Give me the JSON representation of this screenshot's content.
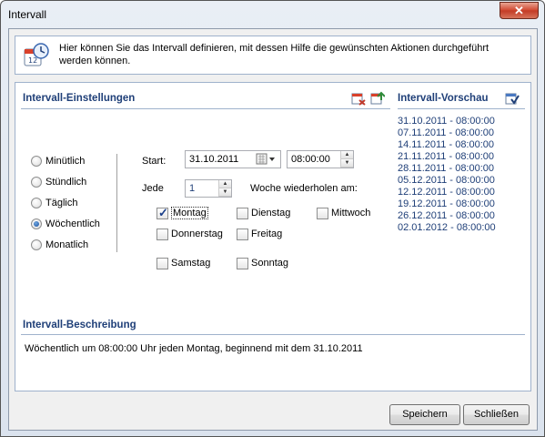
{
  "window": {
    "title": "Intervall",
    "close_label": "✕"
  },
  "info": {
    "text": "Hier können Sie das Intervall definieren, mit dessen Hilfe die gewünschten Aktionen durchgeführt werden können."
  },
  "settings": {
    "title": "Intervall-Einstellungen",
    "frequencies": [
      {
        "label": "Minütlich",
        "selected": false
      },
      {
        "label": "Stündlich",
        "selected": false
      },
      {
        "label": "Täglich",
        "selected": false
      },
      {
        "label": "Wöchentlich",
        "selected": true
      },
      {
        "label": "Monatlich",
        "selected": false
      }
    ],
    "start_label": "Start:",
    "start_date": "31.10.2011",
    "start_time": "08:00:00",
    "every_label": "Jede",
    "every_value": "1",
    "repeat_label": "Woche wiederholen am:",
    "days": [
      {
        "label": "Montag",
        "checked": true
      },
      {
        "label": "Dienstag",
        "checked": false
      },
      {
        "label": "Mittwoch",
        "checked": false
      },
      {
        "label": "Donnerstag",
        "checked": false
      },
      {
        "label": "Freitag",
        "checked": false
      },
      {
        "label": "Samstag",
        "checked": false
      },
      {
        "label": "Sonntag",
        "checked": false
      }
    ]
  },
  "preview": {
    "title": "Intervall-Vorschau",
    "items": [
      "31.10.2011 - 08:00:00",
      "07.11.2011 - 08:00:00",
      "14.11.2011 - 08:00:00",
      "21.11.2011 - 08:00:00",
      "28.11.2011 - 08:00:00",
      "05.12.2011 - 08:00:00",
      "12.12.2011 - 08:00:00",
      "19.12.2011 - 08:00:00",
      "26.12.2011 - 08:00:00",
      "02.01.2012 - 08:00:00"
    ]
  },
  "description": {
    "title": "Intervall-Beschreibung",
    "text": "Wöchentlich um 08:00:00 Uhr jeden Montag, beginnend mit dem 31.10.2011"
  },
  "buttons": {
    "save": "Speichern",
    "close": "Schließen"
  },
  "colors": {
    "accent": "#1f3f78",
    "divider": "#9fb2cc"
  }
}
